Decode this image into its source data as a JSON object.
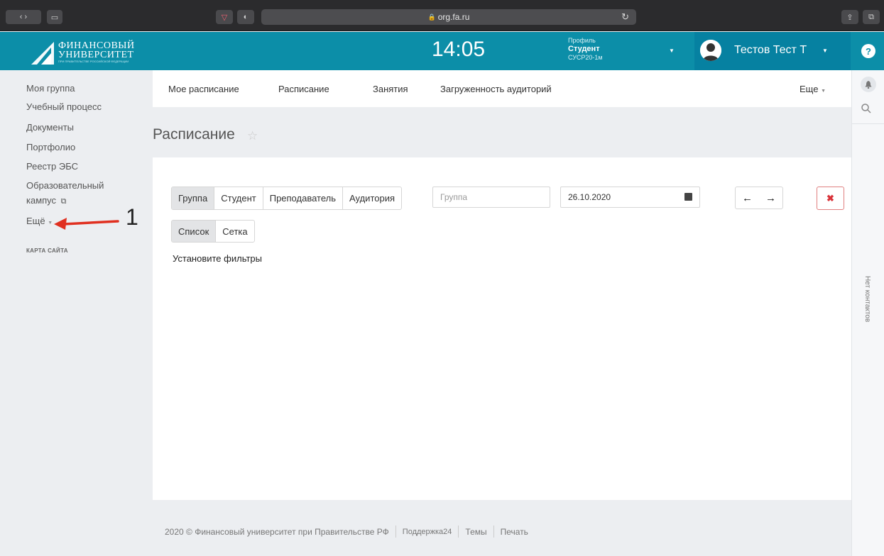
{
  "browser": {
    "url": "org.fa.ru"
  },
  "header": {
    "logo_line1": "ФИНАНСОВЫЙ",
    "logo_line2": "УНИВЕРСИТЕТ",
    "logo_line3": "ПРИ ПРАВИТЕЛЬСТВЕ РОССИЙСКОЙ ФЕДЕРАЦИИ",
    "clock": "14:05",
    "profile_label": "Профиль",
    "profile_role": "Студент",
    "profile_group": "СУСР20-1м",
    "user_name": "Тестов Тест Т",
    "help": "?"
  },
  "sidebar": {
    "items": [
      "Моя группа",
      "Учебный процесс",
      "Документы",
      "Портфолио",
      "Реестр ЭБС",
      "Образовательный",
      "кампус",
      "Ещё"
    ],
    "site_map": "КАРТА САЙТА"
  },
  "nav": {
    "items": [
      "Мое расписание",
      "Расписание",
      "Занятия",
      "Загруженность аудиторий"
    ],
    "more": "Еще"
  },
  "page": {
    "title": "Расписание"
  },
  "filters": {
    "type_tabs": [
      "Группа",
      "Студент",
      "Преподаватель",
      "Аудитория"
    ],
    "active_type": "Группа",
    "group_placeholder": "Группа",
    "date_value": "26.10.2020",
    "view_tabs": [
      "Список",
      "Сетка"
    ],
    "active_view": "Список",
    "message": "Установите фильтры"
  },
  "right_rail": {
    "no_contacts": "Нет контактов"
  },
  "footer": {
    "copyright": "2020 © Финансовый университет при Правительстве РФ",
    "support": "Поддержка24",
    "themes": "Темы",
    "print": "Печать"
  },
  "annotation": {
    "number": "1",
    "color": "#e03020"
  },
  "colors": {
    "header": "#0c8ea8",
    "user_box": "#0681a1",
    "danger": "#d9333a"
  }
}
